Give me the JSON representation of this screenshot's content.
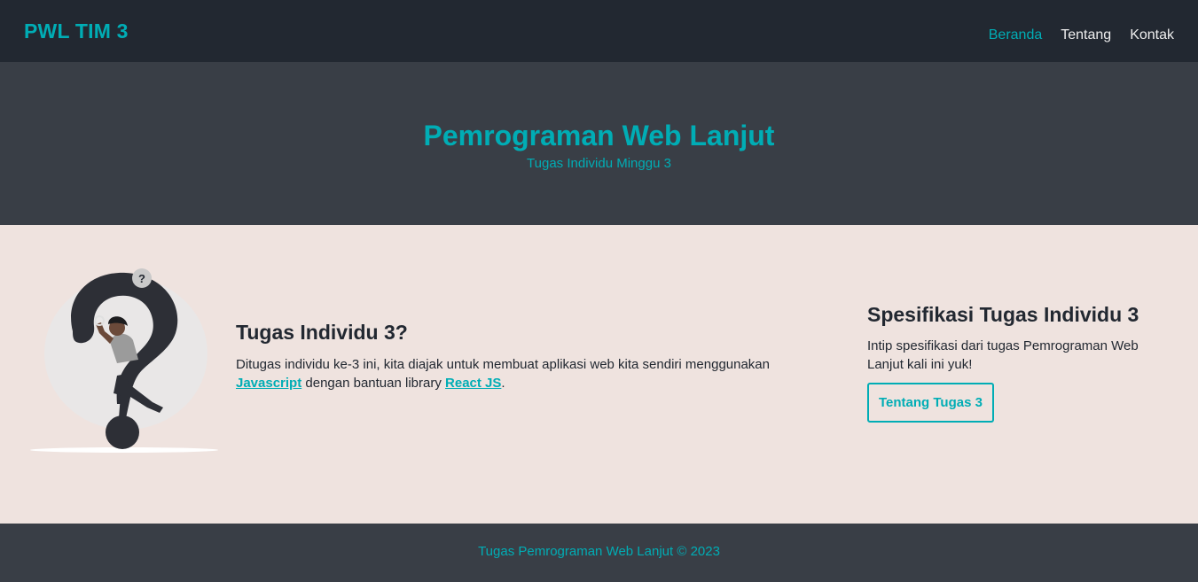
{
  "navbar": {
    "brand": "PWL TIM 3",
    "links": [
      {
        "label": "Beranda",
        "active": true
      },
      {
        "label": "Tentang",
        "active": false
      },
      {
        "label": "Kontak",
        "active": false
      }
    ]
  },
  "hero": {
    "title": "Pemrograman Web Lanjut",
    "subtitle": "Tugas Individu Minggu 3"
  },
  "intro": {
    "title": "Tugas Individu 3?",
    "text_before": "Ditugas individu ke-3 ini, kita diajak untuk membuat aplikasi web kita sendiri menggunakan ",
    "link_javascript": "Javascript",
    "text_middle": " dengan bantuan library ",
    "link_react": "React JS",
    "text_after": "."
  },
  "spec": {
    "title": "Spesifikasi Tugas Individu 3",
    "text": "Intip spesifikasi dari tugas Pemrograman Web Lanjut kali ini yuk!",
    "button_label": "Tentang Tugas 3"
  },
  "footer": {
    "text": "Tugas Pemrograman Web Lanjut © 2023"
  },
  "illustration": {
    "icon": "question-person-illustration",
    "badge_text": "?"
  },
  "colors": {
    "accent": "#00adb5",
    "navbar_bg": "#222831",
    "hero_bg": "#393e46",
    "content_bg": "#efe3df",
    "text_dark": "#222831",
    "nav_text": "#eeeeee"
  }
}
